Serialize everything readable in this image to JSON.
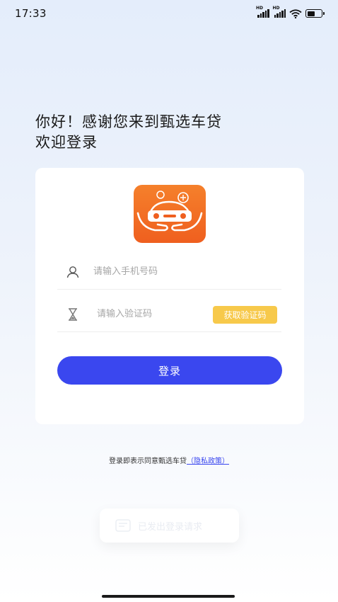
{
  "status_bar": {
    "time": "17:33",
    "signal_1_label": "HD",
    "signal_2_label": "HD",
    "battery_level": 0.55
  },
  "greeting": {
    "line1": "你好！感谢您来到甄选车贷",
    "line2": "欢迎登录"
  },
  "form": {
    "logo_icon": "car-in-hands-icon",
    "phone_placeholder": "请输入手机号码",
    "code_placeholder": "请输入验证码",
    "get_code_label": "获取验证码",
    "login_label": "登录"
  },
  "agreement": {
    "prefix": "登录即表示同意甄选车贷",
    "link": "（隐私政策）"
  },
  "toast": {
    "text": "已发出登录请求"
  },
  "colors": {
    "primary": "#3a47ef",
    "get_code_bg": "#f7c94b",
    "logo_orange": "#f26b22"
  }
}
